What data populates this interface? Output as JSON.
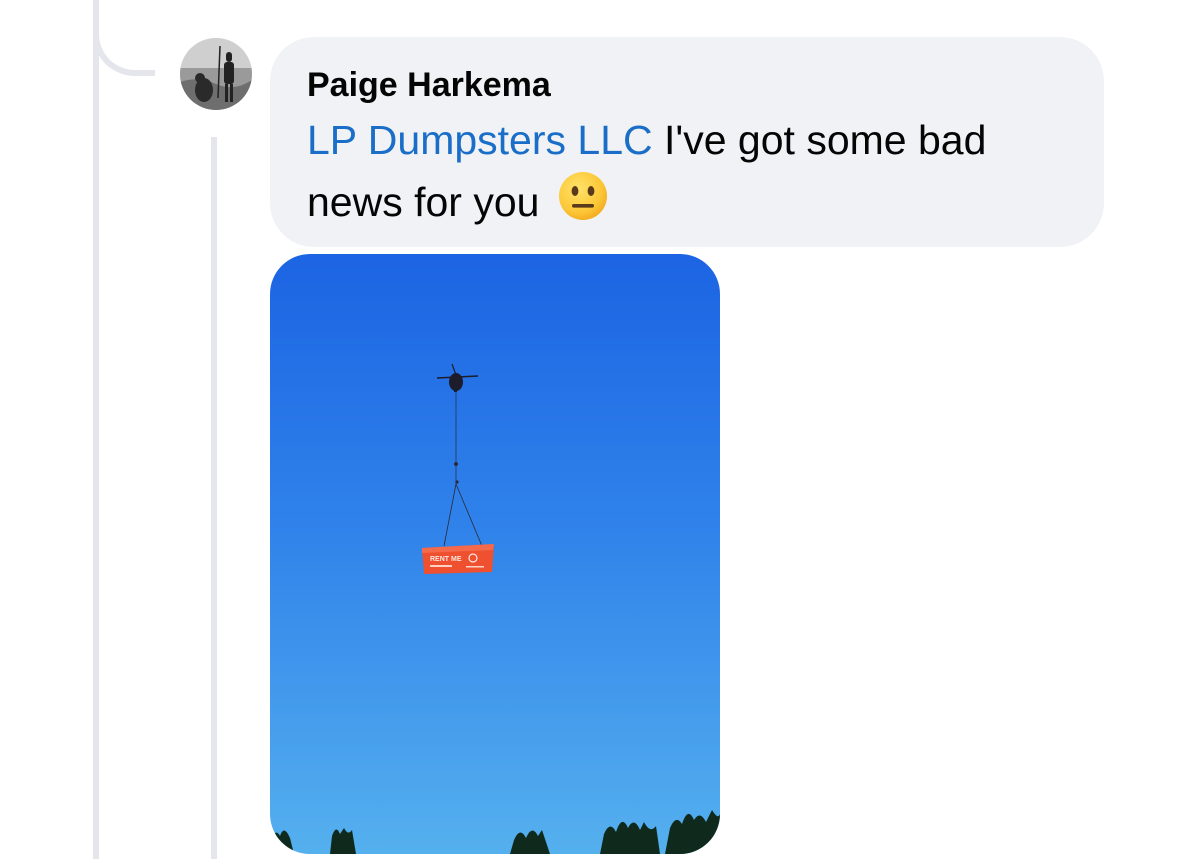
{
  "comment": {
    "author": "Paige Harkema",
    "mention": "LP Dumpsters LLC",
    "text": " I've got some bad news for you",
    "emoji": "neutral-face-emoji"
  },
  "photo": {
    "dumpster_text_line1": "RENT ME"
  },
  "colors": {
    "bubble_background": "#f0f2f5",
    "mention_link": "#1a6ec7",
    "thread_line": "#e4e6eb",
    "sky_top": "#1c64e3",
    "sky_bottom": "#55b0ee",
    "dumpster": "#ee5030"
  }
}
